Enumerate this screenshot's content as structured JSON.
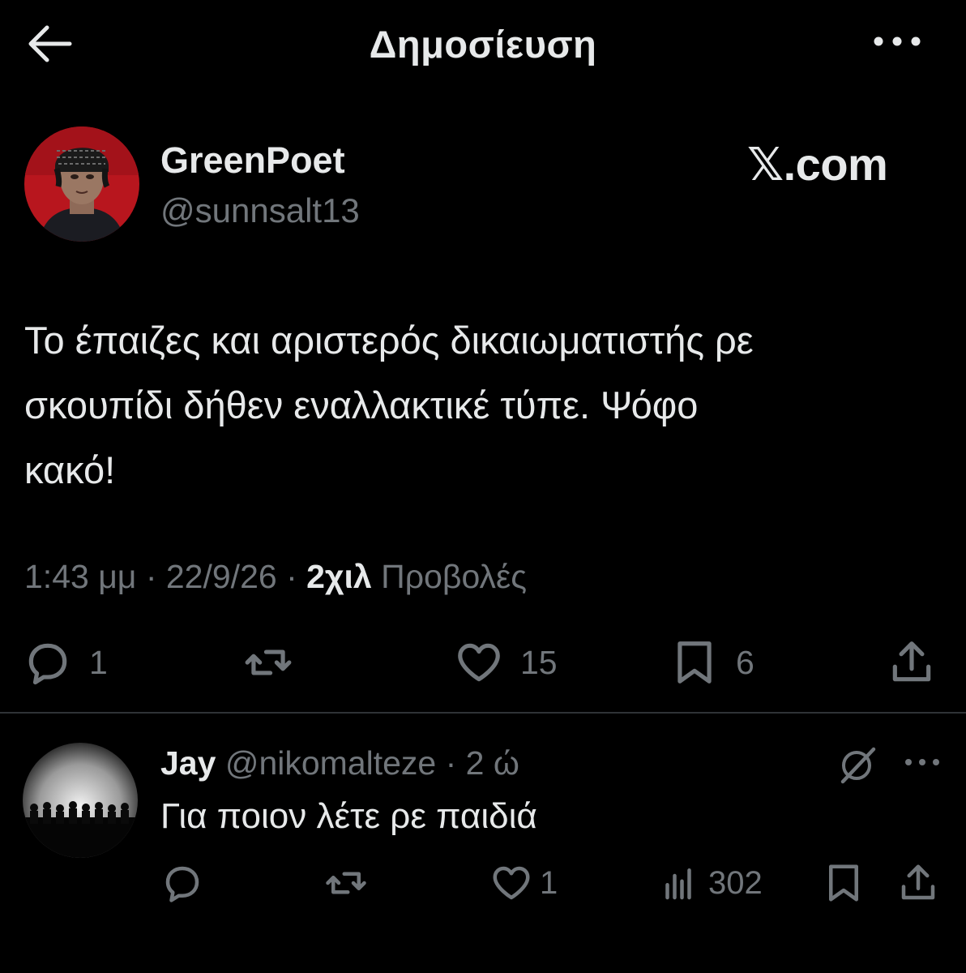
{
  "header": {
    "title": "Δημοσίευση",
    "back_icon": "arrow-left-icon",
    "more_icon": "more-horizontal-icon"
  },
  "post": {
    "author_name": "GreenPoet",
    "author_handle": "@sunnsalt13",
    "watermark": "𝕏.com",
    "text_lines": [
      "Το έπαιζες και αριστερός δικαιωματιστής ρε",
      "σκουπίδι δήθεν εναλλακτικέ τύπε. Ψόφο",
      "κακό!"
    ],
    "time": "1:43 μμ",
    "sep": " · ",
    "date": "22/9/26",
    "views_count": "2χιλ",
    "views_label": "Προβολές",
    "actions": {
      "replies": "1",
      "reposts": "",
      "likes": "15",
      "bookmarks": "6"
    }
  },
  "reply": {
    "name": "Jay",
    "handle": "@nikomalteze",
    "sep": " · ",
    "time": "2 ώ",
    "text": "Για ποιον λέτε ρε παιδιά",
    "actions": {
      "replies": "",
      "reposts": "",
      "likes": "1",
      "views": "302"
    }
  },
  "colors": {
    "background": "#000000",
    "text": "#e7e9ea",
    "secondary": "#71767b",
    "divider": "#2f3336"
  }
}
